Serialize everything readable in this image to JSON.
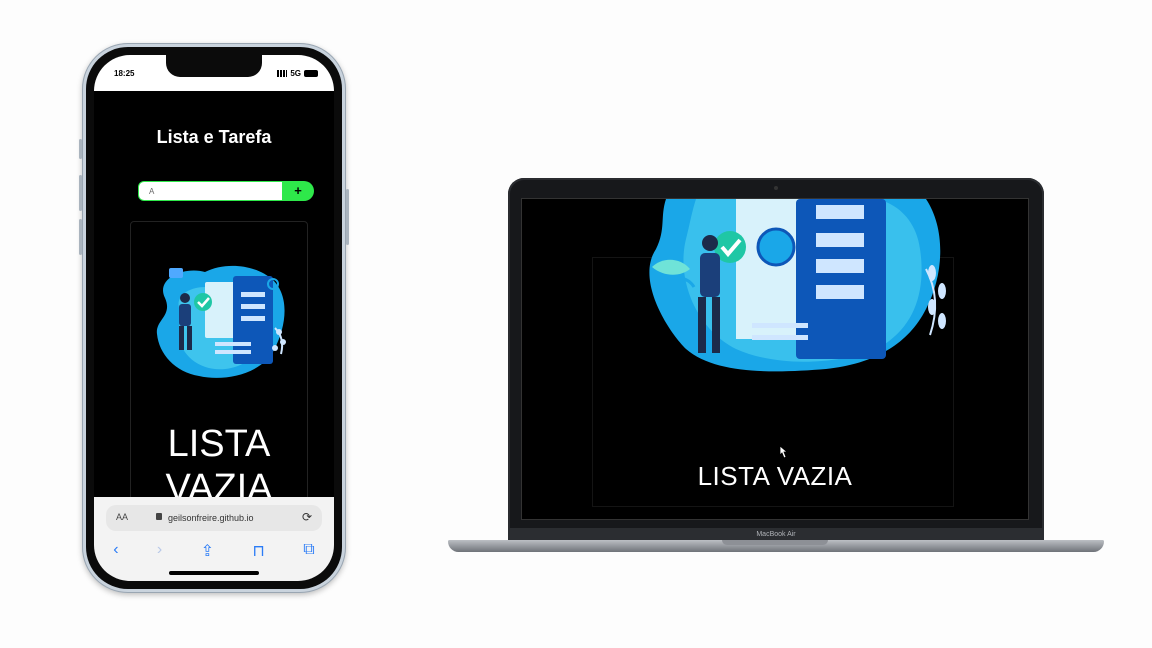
{
  "phone": {
    "status_time": "18:25",
    "status_network": "5G",
    "app_title": "Lista e Tarefa",
    "input_value": "A",
    "add_label": "+",
    "empty_text": "LISTA VAZIA",
    "url_aa": "AA",
    "url": "geilsonfreire.github.io",
    "reload_icon": "⟳",
    "nav": {
      "back": "‹",
      "forward": "›",
      "share": "⇪",
      "bookmarks": "⊓",
      "tabs": "⧉"
    }
  },
  "laptop": {
    "empty_text": "LISTA VAZIA",
    "brand": "MacBook Air"
  },
  "colors": {
    "accent_green": "#2ee84a",
    "illustration_blue": "#1aa7e8",
    "illustration_dark": "#0d57b8"
  }
}
